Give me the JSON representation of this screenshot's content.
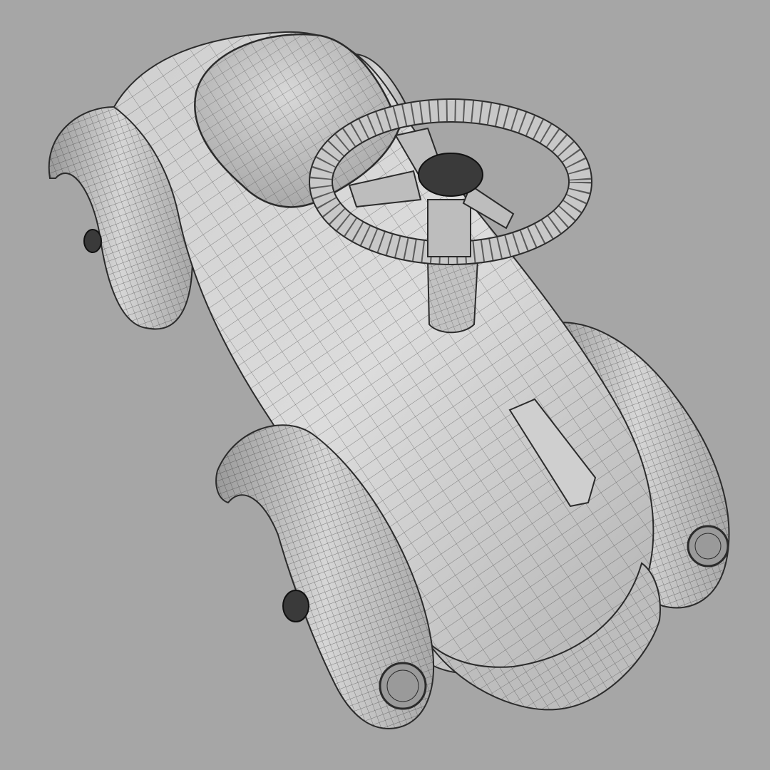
{
  "scene": {
    "subject": "toy-ride-on-car-wireframe-render",
    "view": "top-down-perspective",
    "render_style": "clay-shaded-with-mesh-wireframe",
    "colors": {
      "background": "#a6a6a6",
      "body_light": "#d4d4d4",
      "body_mid": "#b9b9b9",
      "body_dark": "#8e8e8e",
      "wire": "#2b2b2b",
      "hub": "#3a3a3a"
    },
    "parts": [
      "body",
      "seat",
      "steering-wheel",
      "steering-column",
      "hood-ornament",
      "front-bumper",
      "fenders",
      "headlights",
      "axle-hubs"
    ]
  }
}
